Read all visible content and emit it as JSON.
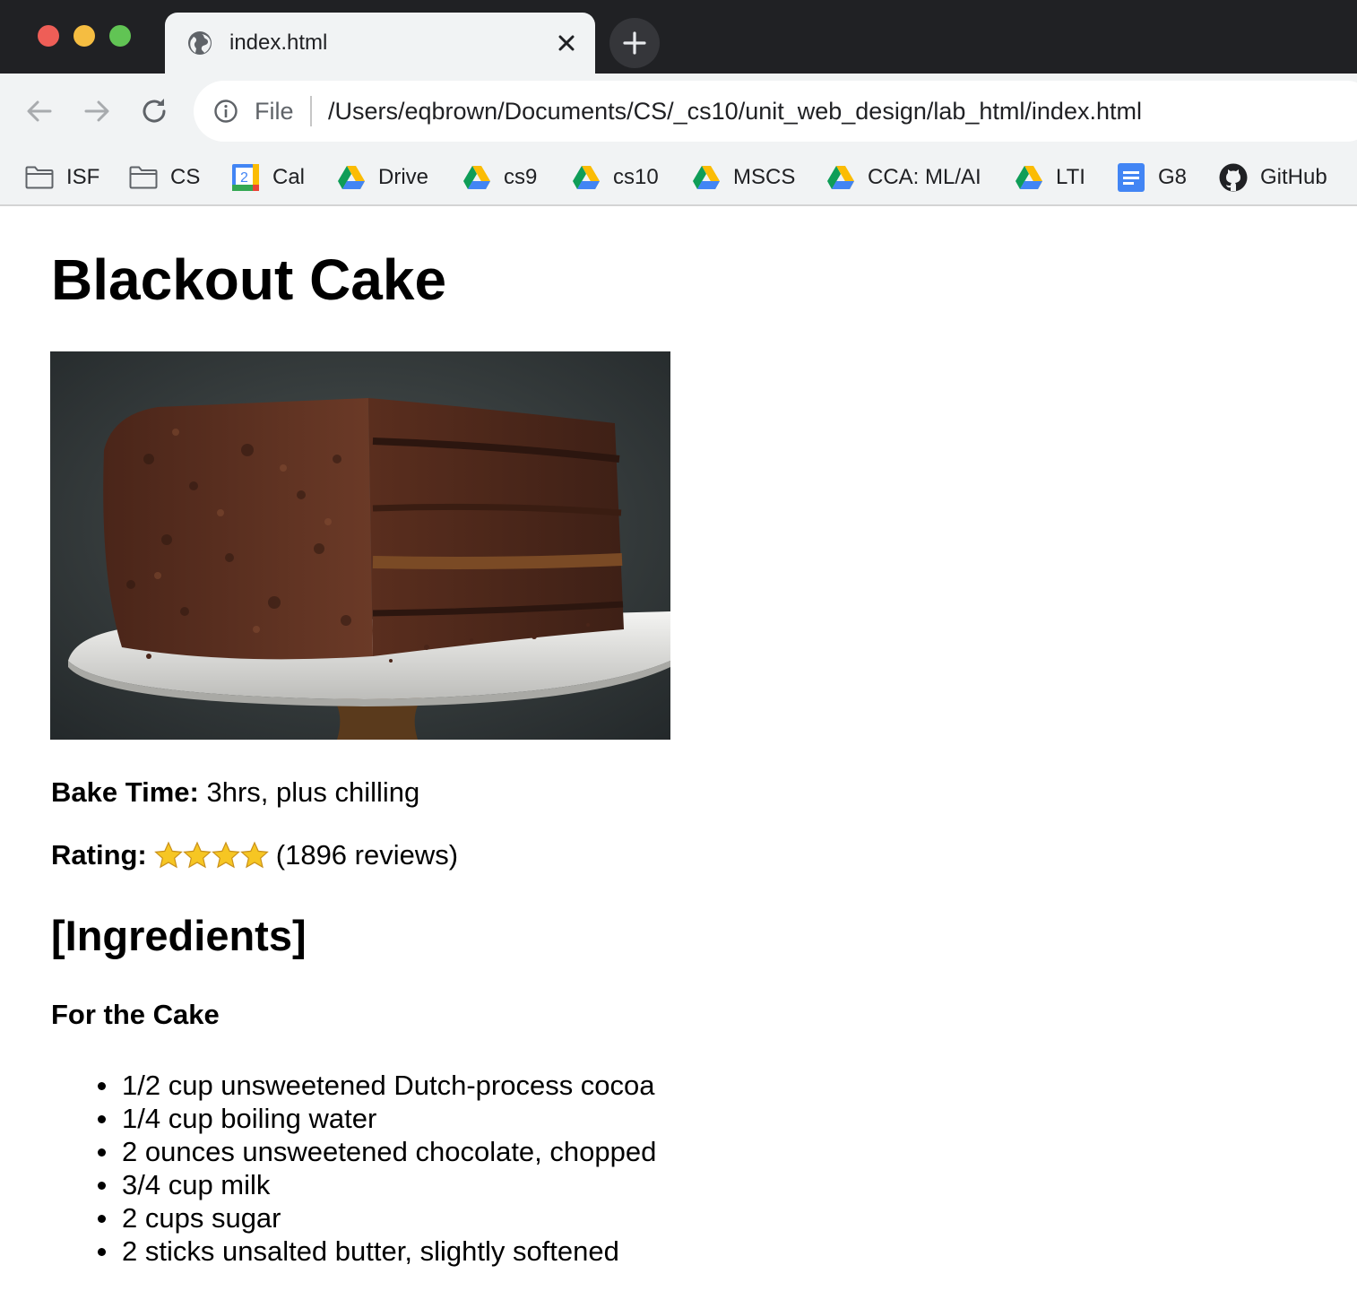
{
  "browser": {
    "tab": {
      "title": "index.html",
      "icon": "globe-icon"
    },
    "address": {
      "scheme": "File",
      "url": "/Users/eqbrown/Documents/CS/_cs10/unit_web_design/lab_html/index.html"
    },
    "bookmarks": [
      {
        "label": "ISF",
        "icon": "folder-icon"
      },
      {
        "label": "CS",
        "icon": "folder-icon"
      },
      {
        "label": "Cal",
        "icon": "calendar-icon",
        "icon_text": "2"
      },
      {
        "label": "Drive",
        "icon": "google-drive-icon"
      },
      {
        "label": "cs9",
        "icon": "google-drive-icon"
      },
      {
        "label": "cs10",
        "icon": "google-drive-icon"
      },
      {
        "label": "MSCS",
        "icon": "google-drive-icon"
      },
      {
        "label": "CCA: ML/AI",
        "icon": "google-drive-icon"
      },
      {
        "label": "LTI",
        "icon": "google-drive-icon"
      },
      {
        "label": "G8",
        "icon": "google-docs-icon"
      },
      {
        "label": "GitHub",
        "icon": "github-icon"
      }
    ]
  },
  "page": {
    "title": "Blackout Cake",
    "bake_time": {
      "label": "Bake Time:",
      "value": "3hrs, plus chilling"
    },
    "rating": {
      "label": "Rating:",
      "stars": 4,
      "reviews": "(1896 reviews)"
    },
    "ingredients_heading": "[Ingredients]",
    "cake_heading": "For the Cake",
    "ingredients": [
      "1/2 cup unsweetened Dutch-process cocoa",
      "1/4 cup boiling water",
      "2 ounces unsweetened chocolate, chopped",
      "3/4 cup milk",
      "2 cups sugar",
      "2 sticks unsalted butter, slightly softened"
    ]
  },
  "colors": {
    "titlebar": "#202124",
    "toolbar": "#f1f3f4",
    "traffic_red": "#ee5e57",
    "traffic_yellow": "#f5bd41",
    "traffic_green": "#61c454",
    "star": "#f6c623"
  }
}
